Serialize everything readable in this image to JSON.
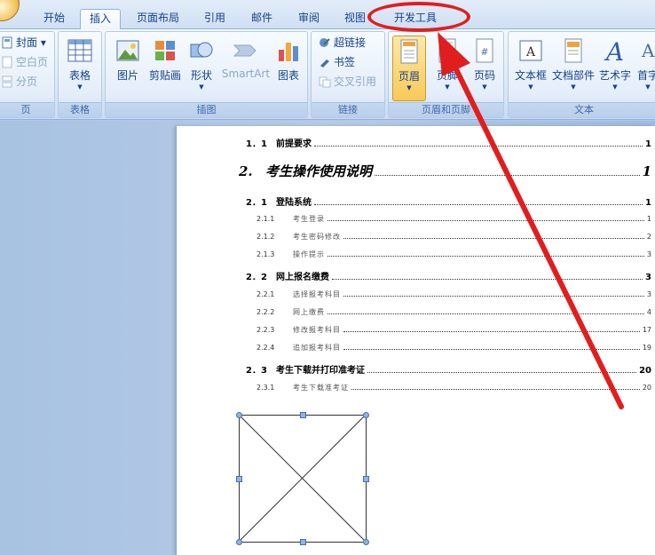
{
  "tabs": [
    {
      "label": "开始"
    },
    {
      "label": "插入"
    },
    {
      "label": "页面布局"
    },
    {
      "label": "引用"
    },
    {
      "label": "邮件"
    },
    {
      "label": "审阅"
    },
    {
      "label": "视图"
    },
    {
      "label": "开发工具"
    }
  ],
  "ribbon": {
    "pages": {
      "title": "页",
      "cover": "封面",
      "blank": "空白页",
      "break": "分页"
    },
    "table": {
      "title": "表格",
      "table": "表格"
    },
    "illustrations": {
      "title": "插图",
      "picture": "图片",
      "clipart": "剪贴画",
      "shape": "形状",
      "smartart": "SmartArt",
      "chart": "图表"
    },
    "links": {
      "title": "链接",
      "hyperlink": "超链接",
      "bookmark": "书签",
      "crossref": "交叉引用"
    },
    "header_footer": {
      "title": "页眉和页脚",
      "header": "页眉",
      "footer": "页脚",
      "pagenum": "页码"
    },
    "text": {
      "title": "文本",
      "textbox": "文本框",
      "quickparts": "文档部件",
      "wordart": "艺术字",
      "dropcap": "首字"
    }
  },
  "toc": [
    {
      "num": "1．1",
      "title": "前提要求",
      "page": "1"
    },
    {
      "num": "2.",
      "title": "考生操作使用说明",
      "page": "1"
    },
    {
      "num": "2．1",
      "title": "登陆系统",
      "page": "1"
    },
    {
      "num": "2.1.1",
      "title": "考生登录",
      "page": "1"
    },
    {
      "num": "2.1.2",
      "title": "考生密码修改",
      "page": "2"
    },
    {
      "num": "2.1.3",
      "title": "操作提示",
      "page": "3"
    },
    {
      "num": "2．2",
      "title": "网上报名缴费",
      "page": "3"
    },
    {
      "num": "2.2.1",
      "title": "选择报考科目",
      "page": "3"
    },
    {
      "num": "2.2.2",
      "title": "网上缴费",
      "page": "4"
    },
    {
      "num": "2.2.3",
      "title": "修改报考科目",
      "page": "17"
    },
    {
      "num": "2.2.4",
      "title": "追加报考科目",
      "page": "19"
    },
    {
      "num": "2．3",
      "title": "考生下载并打印准考证",
      "page": "20"
    },
    {
      "num": "2.3.1",
      "title": "考生下载准考证",
      "page": "20"
    }
  ],
  "colors": {
    "annotation": "#e11e1e",
    "ribbon_text": "#15428b",
    "highlight_group": "#f8dc93"
  }
}
